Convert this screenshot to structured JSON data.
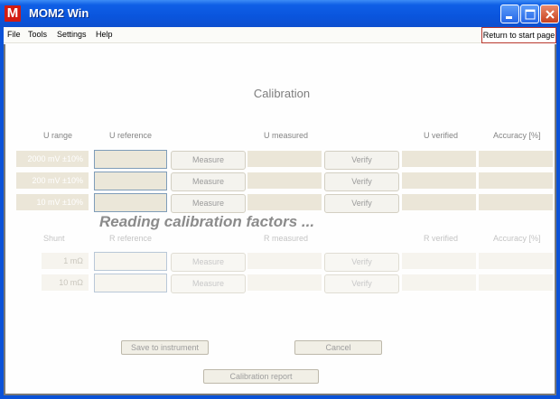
{
  "window": {
    "title": "MOM2 Win",
    "icon_letter": "M"
  },
  "menu": {
    "file": "File",
    "tools": "Tools",
    "settings": "Settings",
    "help": "Help",
    "return_button": "Return to start page"
  },
  "heading": "Calibration",
  "status": "Reading calibration factors ...",
  "voltage": {
    "headers": {
      "range": "U range",
      "reference": "U reference",
      "measured": "U measured",
      "verified": "U verified",
      "accuracy": "Accuracy [%]"
    },
    "rows": [
      {
        "range": "2000 mV ±10%",
        "measure": "Measure",
        "verify": "Verify"
      },
      {
        "range": "200 mV ±10%",
        "measure": "Measure",
        "verify": "Verify"
      },
      {
        "range": "10 mV ±10%",
        "measure": "Measure",
        "verify": "Verify"
      }
    ]
  },
  "shunt": {
    "headers": {
      "range": "Shunt",
      "reference": "R reference",
      "measured": "R measured",
      "verified": "R verified",
      "accuracy": "Accuracy [%]"
    },
    "rows": [
      {
        "range": "1 mΩ",
        "measure": "Measure",
        "verify": "Verify"
      },
      {
        "range": "10 mΩ",
        "measure": "Measure",
        "verify": "Verify"
      }
    ]
  },
  "actions": {
    "save": "Save to instrument",
    "cancel": "Cancel",
    "report": "Calibration report"
  },
  "colors": {
    "titlebar": "#0a55dd",
    "close_button": "#c8411f",
    "field_background": "#ebe6d8",
    "heading_text": "#7d7d7d"
  }
}
